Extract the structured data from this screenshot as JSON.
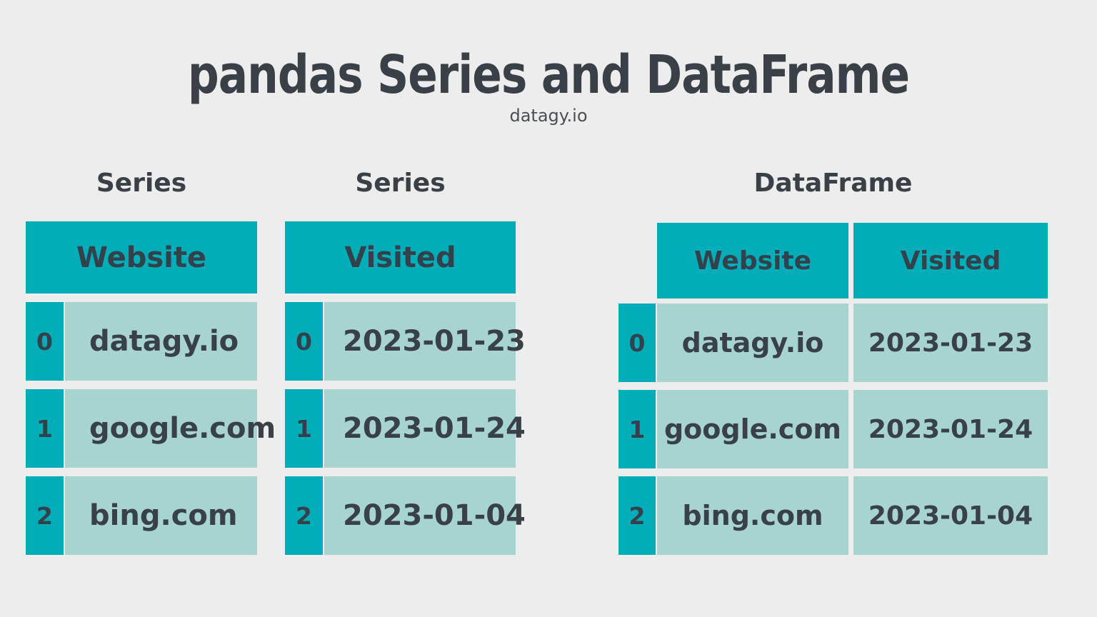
{
  "header": {
    "title": "pandas Series and DataFrame",
    "subtitle": "datagy.io"
  },
  "colors": {
    "background": "#ededed",
    "teal_header": "#00adb8",
    "teal_light_cell": "#a7d4cf",
    "text_dark": "#3a4048"
  },
  "sections": [
    {
      "caption": "Series",
      "column": "Website",
      "index": [
        "0",
        "1",
        "2"
      ],
      "values": [
        "datagy.io",
        "google.com",
        "bing.com"
      ]
    },
    {
      "caption": "Series",
      "column": "Visited",
      "index": [
        "0",
        "1",
        "2"
      ],
      "values": [
        "2023-01-23",
        "2023-01-24",
        "2023-01-04"
      ]
    },
    {
      "caption": "DataFrame",
      "columns": [
        "Website",
        "Visited"
      ],
      "index": [
        "0",
        "1",
        "2"
      ],
      "rows": [
        [
          "datagy.io",
          "2023-01-23"
        ],
        [
          "google.com",
          "2023-01-24"
        ],
        [
          "bing.com",
          "2023-01-04"
        ]
      ]
    }
  ]
}
